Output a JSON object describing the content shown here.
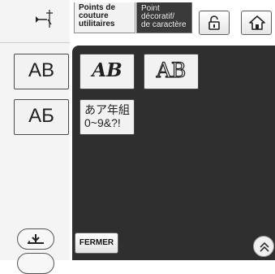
{
  "tabs": {
    "utility_lines": [
      "Points de",
      "couture",
      "utilitaires"
    ],
    "decorative_lines": [
      "Point",
      "décoratif/",
      "de caractère"
    ]
  },
  "fonts": {
    "roman": "AB",
    "script": "AB",
    "outline": "AB",
    "cyrillic": "АБ",
    "japanese_line1": "あア年組",
    "japanese_line2": "0~9&?!"
  },
  "buttons": {
    "close_label": "FERMER"
  },
  "icons": {
    "needle": "needle-position-icon",
    "lock": "lock-icon",
    "home": "home-icon",
    "presser_foot": "presser-foot-icon",
    "scroll": "double-chevron-up-icon"
  },
  "colors": {
    "panel": "#2f2f2f",
    "button_face": "#f2f2f2",
    "active_tab": "#3a3a3a"
  }
}
